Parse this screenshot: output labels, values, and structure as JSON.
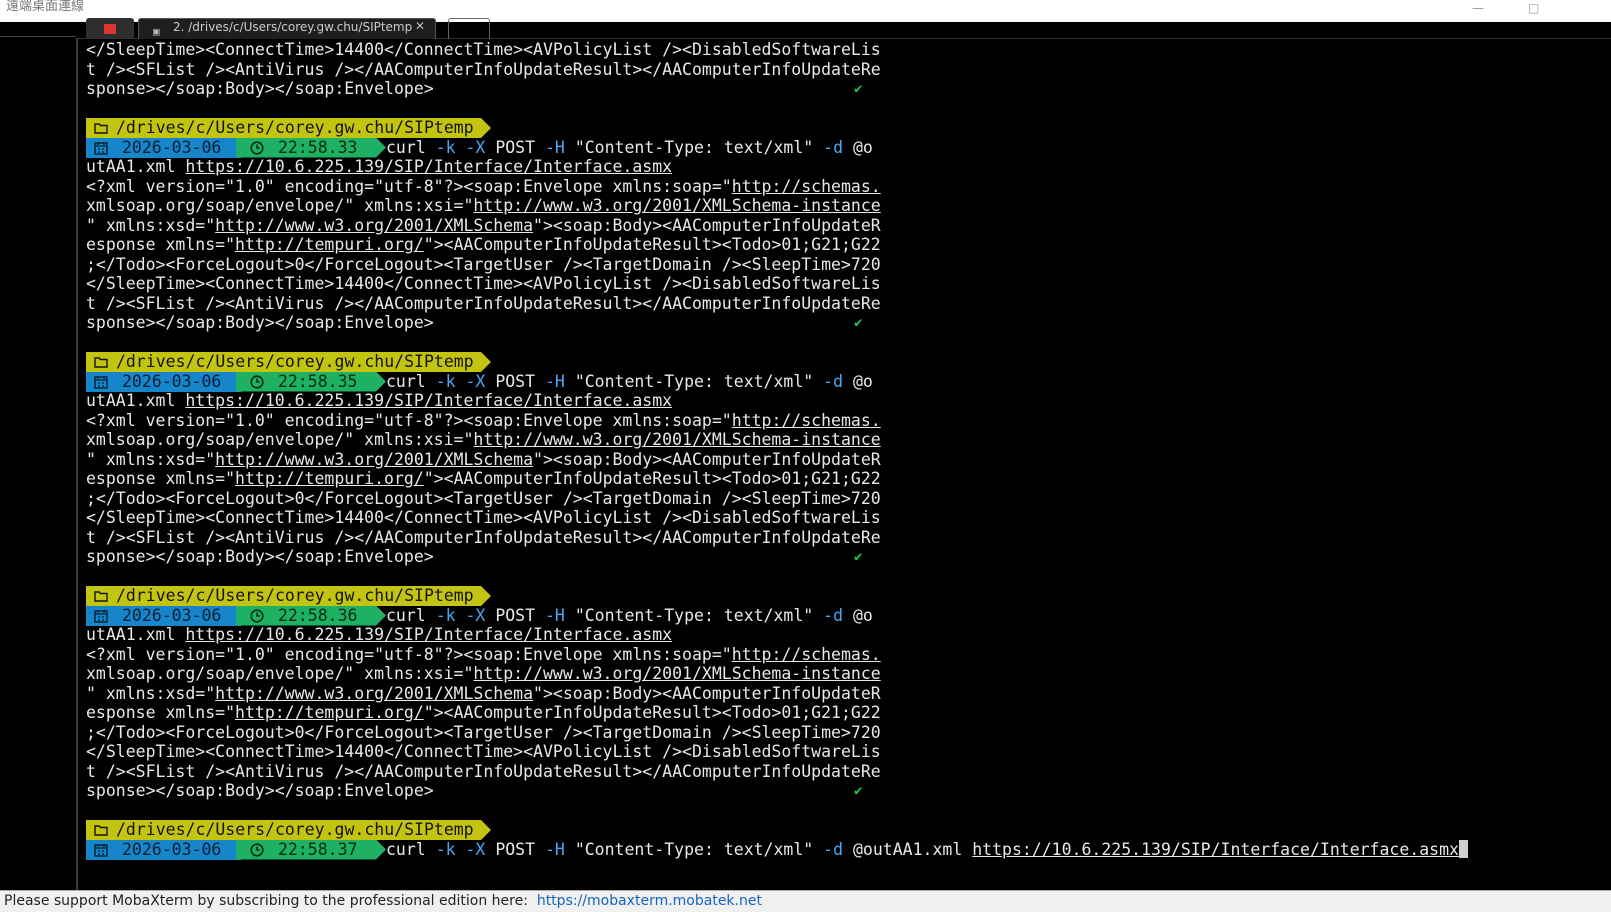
{
  "window": {
    "title": "遠端桌面連線",
    "minimize_glyph": "—",
    "maximize_glyph": "□"
  },
  "tabs": {
    "session_label": "2. /drives/c/Users/corey.gw.chu/SIPtemp",
    "close_glyph": "✕"
  },
  "colors": {
    "path_segment": "#c2c40f",
    "date_segment": "#1785c9",
    "time_segment": "#1eb063",
    "option_flag": "#4aa6f2",
    "success_check": "#18cc55"
  },
  "terminal": {
    "top_output": [
      "</SleepTime><ConnectTime>14400</ConnectTime><AVPolicyList /><DisabledSoftwareLis",
      "t /><SFList /><AntiVirus /></AAComputerInfoUpdateResult></AAComputerInfoUpdateRe",
      "sponse></soap:Body></soap:Envelope>"
    ],
    "check_glyph": "✔",
    "prompt": {
      "path": "/drives/c/Users/corey.gw.chu/SIPtemp",
      "date": "2026-03-06"
    },
    "command": {
      "program": "curl",
      "k_flag": "-k",
      "x_flag": "-X",
      "method": "POST",
      "h_flag": "-H",
      "header": "\"Content-Type: text/xml\"",
      "d_flag": "-d",
      "data_wrapped_a": "@o",
      "data_wrapped_b": "utAA1.xml",
      "data_full": "@outAA1.xml",
      "url": "https://10.6.225.139/SIP/Interface/Interface.asmx"
    },
    "blocks": [
      {
        "time": "22:58.33",
        "response": {
          "l1": "<?xml version=\"1.0\" encoding=\"utf-8\"?><soap:Envelope xmlns:soap=\"",
          "l1_url": "http://schemas.",
          "l2_url_a": "xmlsoap.org/soap/envelope/",
          "l2": "\" xmlns:xsi=\"",
          "l2_url_b": "http://www.w3.org/2001/XMLSchema-instance",
          "l3_a": "\" xmlns:xsd=\"",
          "l3_url": "http://www.w3.org/2001/XMLSchema",
          "l3_b": "\"><soap:Body><AAComputerInfoUpdateR",
          "l4_a": "esponse xmlns=\"",
          "l4_url": "http://tempuri.org/",
          "l4_b": "\"><AAComputerInfoUpdateResult><Todo>01;G21;G22",
          "l5": ";</Todo><ForceLogout>0</ForceLogout><TargetUser /><TargetDomain /><SleepTime>720",
          "l6": "</SleepTime><ConnectTime>14400</ConnectTime><AVPolicyList /><DisabledSoftwareLis",
          "l7": "t /><SFList /><AntiVirus /></AAComputerInfoUpdateResult></AAComputerInfoUpdateRe",
          "l8": "sponse></soap:Body></soap:Envelope>"
        }
      },
      {
        "time": "22:58.35",
        "response": {
          "l1": "<?xml version=\"1.0\" encoding=\"utf-8\"?><soap:Envelope xmlns:soap=\"",
          "l1_url": "http://schemas.",
          "l2_url_a": "xmlsoap.org/soap/envelope/",
          "l2": "\" xmlns:xsi=\"",
          "l2_url_b": "http://www.w3.org/2001/XMLSchema-instance",
          "l3_a": "\" xmlns:xsd=\"",
          "l3_url": "http://www.w3.org/2001/XMLSchema",
          "l3_b": "\"><soap:Body><AAComputerInfoUpdateR",
          "l4_a": "esponse xmlns=\"",
          "l4_url": "http://tempuri.org/",
          "l4_b": "\"><AAComputerInfoUpdateResult><Todo>01;G21;G22",
          "l5": ";</Todo><ForceLogout>0</ForceLogout><TargetUser /><TargetDomain /><SleepTime>720",
          "l6": "</SleepTime><ConnectTime>14400</ConnectTime><AVPolicyList /><DisabledSoftwareLis",
          "l7": "t /><SFList /><AntiVirus /></AAComputerInfoUpdateResult></AAComputerInfoUpdateRe",
          "l8": "sponse></soap:Body></soap:Envelope>"
        }
      },
      {
        "time": "22:58.36",
        "response": {
          "l1": "<?xml version=\"1.0\" encoding=\"utf-8\"?><soap:Envelope xmlns:soap=\"",
          "l1_url": "http://schemas.",
          "l2_url_a": "xmlsoap.org/soap/envelope/",
          "l2": "\" xmlns:xsi=\"",
          "l2_url_b": "http://www.w3.org/2001/XMLSchema-instance",
          "l3_a": "\" xmlns:xsd=\"",
          "l3_url": "http://www.w3.org/2001/XMLSchema",
          "l3_b": "\"><soap:Body><AAComputerInfoUpdateR",
          "l4_a": "esponse xmlns=\"",
          "l4_url": "http://tempuri.org/",
          "l4_b": "\"><AAComputerInfoUpdateResult><Todo>01;G21;G22",
          "l5": ";</Todo><ForceLogout>0</ForceLogout><TargetUser /><TargetDomain /><SleepTime>720",
          "l6": "</SleepTime><ConnectTime>14400</ConnectTime><AVPolicyList /><DisabledSoftwareLis",
          "l7": "t /><SFList /><AntiVirus /></AAComputerInfoUpdateResult></AAComputerInfoUpdateRe",
          "l8": "sponse></soap:Body></soap:Envelope>"
        }
      }
    ],
    "current": {
      "time": "22:58.37"
    }
  },
  "status_bar": {
    "text": "Please support MobaXterm by subscribing to the professional edition here:  ",
    "link": "https://mobaxterm.mobatek.net"
  }
}
